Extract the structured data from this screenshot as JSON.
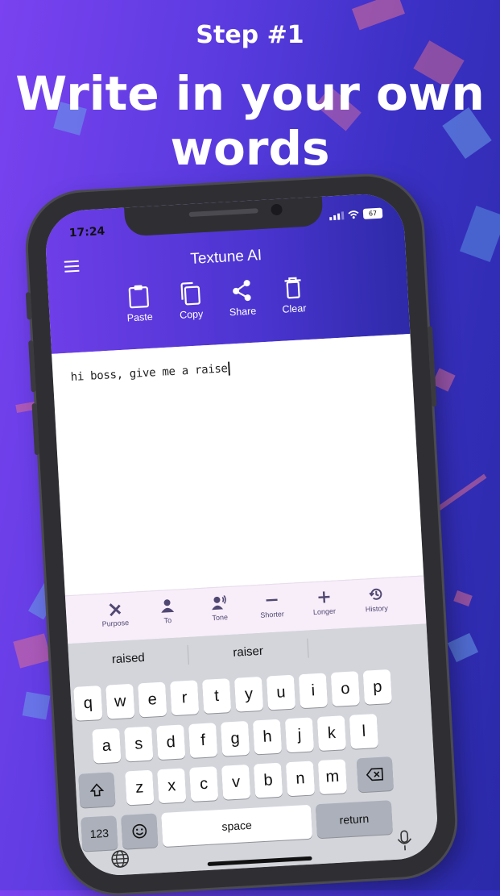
{
  "promo": {
    "step": "Step #1",
    "headline_line1": "Write in your own",
    "headline_line2": "words"
  },
  "status_bar": {
    "time": "17:24",
    "battery": "67"
  },
  "header": {
    "title": "Textune AI",
    "tools": [
      {
        "label": "Paste",
        "icon": "clipboard-icon"
      },
      {
        "label": "Copy",
        "icon": "copy-icon"
      },
      {
        "label": "Share",
        "icon": "share-icon"
      },
      {
        "label": "Clear",
        "icon": "trash-icon"
      }
    ]
  },
  "editor": {
    "text": "hi boss, give me a raise"
  },
  "actions": [
    {
      "label": "Purpose",
      "icon": "pencil-ruler-icon"
    },
    {
      "label": "To",
      "icon": "person-icon"
    },
    {
      "label": "Tone",
      "icon": "speaking-person-icon"
    },
    {
      "label": "Shorter",
      "icon": "minus-icon"
    },
    {
      "label": "Longer",
      "icon": "plus-icon"
    },
    {
      "label": "History",
      "icon": "history-icon"
    }
  ],
  "keyboard": {
    "suggestions": [
      "raised",
      "raiser",
      ""
    ],
    "row1": [
      "q",
      "w",
      "e",
      "r",
      "t",
      "y",
      "u",
      "i",
      "o",
      "p"
    ],
    "row2": [
      "a",
      "s",
      "d",
      "f",
      "g",
      "h",
      "j",
      "k",
      "l"
    ],
    "row3": [
      "z",
      "x",
      "c",
      "v",
      "b",
      "n",
      "m"
    ],
    "numbers_key": "123",
    "space_key": "space",
    "return_key": "return"
  },
  "colors": {
    "accent": "#6e3ee8",
    "action_bar_bg": "#f8eefa",
    "action_icon": "#514872"
  }
}
